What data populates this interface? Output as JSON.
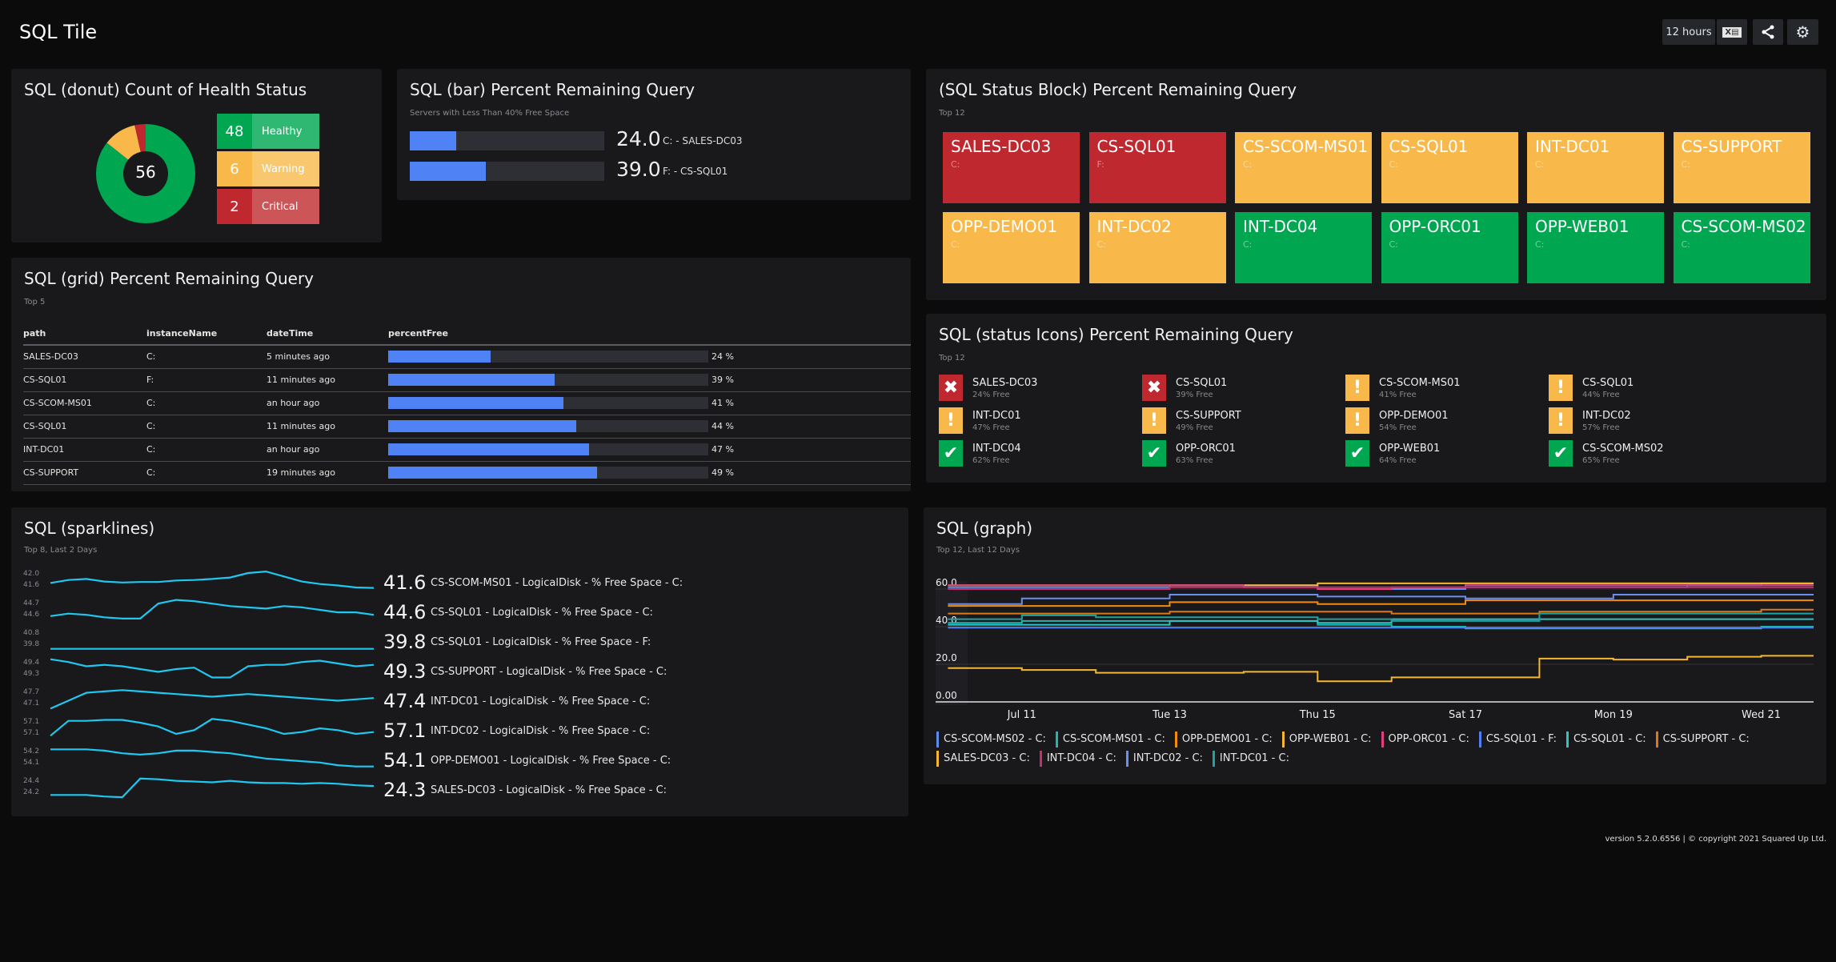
{
  "header": {
    "title": "SQL Tile",
    "time_range": "12 hours",
    "icons": [
      "excel-export-icon",
      "share-icon",
      "gear-icon"
    ]
  },
  "colors": {
    "healthy": "#00a650",
    "warning": "#f8b94a",
    "critical": "#c0282f",
    "bar": "#4f83f5",
    "spark": "#1ec8f0"
  },
  "donut": {
    "title": "SQL (donut) Count of Health Status",
    "total": "56",
    "items": [
      {
        "label": "Healthy",
        "count": 48,
        "count_text": "48",
        "status": "healthy"
      },
      {
        "label": "Warning",
        "count": 6,
        "count_text": "6",
        "status": "warning"
      },
      {
        "label": "Critical",
        "count": 2,
        "count_text": "2",
        "status": "critical"
      }
    ]
  },
  "bar": {
    "title": "SQL (bar) Percent Remaining Query",
    "subtitle": "Servers with Less Than 40% Free Space",
    "items": [
      {
        "value": 24.0,
        "value_text": "24.0",
        "label": "C: - SALES-DC03"
      },
      {
        "value": 39.0,
        "value_text": "39.0",
        "label": "F: - CS-SQL01"
      }
    ]
  },
  "grid": {
    "title": "SQL (grid) Percent Remaining Query",
    "subtitle": "Top 5",
    "columns": [
      "path",
      "instanceName",
      "dateTime",
      "percentFree"
    ],
    "rows": [
      {
        "path": "SALES-DC03",
        "instanceName": "C:",
        "dateTime": "5 minutes ago",
        "percentFree": 24,
        "percent_text": "24 %"
      },
      {
        "path": "CS-SQL01",
        "instanceName": "F:",
        "dateTime": "11 minutes ago",
        "percentFree": 39,
        "percent_text": "39 %"
      },
      {
        "path": "CS-SCOM-MS01",
        "instanceName": "C:",
        "dateTime": "an hour ago",
        "percentFree": 41,
        "percent_text": "41 %"
      },
      {
        "path": "CS-SQL01",
        "instanceName": "C:",
        "dateTime": "11 minutes ago",
        "percentFree": 44,
        "percent_text": "44 %"
      },
      {
        "path": "INT-DC01",
        "instanceName": "C:",
        "dateTime": "an hour ago",
        "percentFree": 47,
        "percent_text": "47 %"
      },
      {
        "path": "CS-SUPPORT",
        "instanceName": "C:",
        "dateTime": "19 minutes ago",
        "percentFree": 49,
        "percent_text": "49 %"
      }
    ]
  },
  "status_block": {
    "title": "(SQL Status Block) Percent Remaining Query",
    "subtitle": "Top 12",
    "tiles": [
      {
        "name": "SALES-DC03",
        "sub": "C:",
        "status": "critical"
      },
      {
        "name": "CS-SQL01",
        "sub": "F:",
        "status": "critical"
      },
      {
        "name": "CS-SCOM-MS01",
        "sub": "C:",
        "status": "warning"
      },
      {
        "name": "CS-SQL01",
        "sub": "C:",
        "status": "warning"
      },
      {
        "name": "INT-DC01",
        "sub": "C:",
        "status": "warning"
      },
      {
        "name": "CS-SUPPORT",
        "sub": "C:",
        "status": "warning"
      },
      {
        "name": "OPP-DEMO01",
        "sub": "C:",
        "status": "warning"
      },
      {
        "name": "INT-DC02",
        "sub": "C:",
        "status": "warning"
      },
      {
        "name": "INT-DC04",
        "sub": "C:",
        "status": "healthy"
      },
      {
        "name": "OPP-ORC01",
        "sub": "C:",
        "status": "healthy"
      },
      {
        "name": "OPP-WEB01",
        "sub": "C:",
        "status": "healthy"
      },
      {
        "name": "CS-SCOM-MS02",
        "sub": "C:",
        "status": "healthy"
      }
    ]
  },
  "status_icons": {
    "title": "SQL (status Icons) Percent Remaining Query",
    "subtitle": "Top 12",
    "items": [
      {
        "name": "SALES-DC03",
        "free": "24% Free",
        "status": "critical"
      },
      {
        "name": "CS-SQL01",
        "free": "39% Free",
        "status": "critical"
      },
      {
        "name": "CS-SCOM-MS01",
        "free": "41% Free",
        "status": "warning"
      },
      {
        "name": "CS-SQL01",
        "free": "44% Free",
        "status": "warning"
      },
      {
        "name": "INT-DC01",
        "free": "47% Free",
        "status": "warning"
      },
      {
        "name": "CS-SUPPORT",
        "free": "49% Free",
        "status": "warning"
      },
      {
        "name": "OPP-DEMO01",
        "free": "54% Free",
        "status": "warning"
      },
      {
        "name": "INT-DC02",
        "free": "57% Free",
        "status": "warning"
      },
      {
        "name": "INT-DC04",
        "free": "62% Free",
        "status": "healthy"
      },
      {
        "name": "OPP-ORC01",
        "free": "63% Free",
        "status": "healthy"
      },
      {
        "name": "OPP-WEB01",
        "free": "64% Free",
        "status": "healthy"
      },
      {
        "name": "CS-SCOM-MS02",
        "free": "65% Free",
        "status": "healthy"
      }
    ]
  },
  "sparklines": {
    "title": "SQL (sparklines)",
    "subtitle": "Top 8, Last 2 Days",
    "rows": [
      {
        "label": "CS-SCOM-MS01 - LogicalDisk - % Free Space - C:",
        "value": "41.6",
        "ticks": [
          "42.0",
          "41.6"
        ],
        "ylim": [
          41.55,
          42.0
        ],
        "values": [
          41.72,
          41.78,
          41.8,
          41.75,
          41.73,
          41.74,
          41.74,
          41.77,
          41.78,
          41.8,
          41.83,
          41.92,
          41.95,
          41.85,
          41.75,
          41.7,
          41.67,
          41.63,
          41.62
        ]
      },
      {
        "label": "CS-SQL01 - LogicalDisk - % Free Space - C:",
        "value": "44.6",
        "ticks": [
          "44.7",
          "44.6"
        ],
        "ylim": [
          44.56,
          44.74
        ],
        "values": [
          44.6,
          44.62,
          44.61,
          44.59,
          44.58,
          44.58,
          44.7,
          44.73,
          44.72,
          44.7,
          44.68,
          44.67,
          44.66,
          44.68,
          44.67,
          44.65,
          44.63,
          44.63,
          44.61
        ]
      },
      {
        "label": "CS-SQL01 - LogicalDisk - % Free Space - F:",
        "value": "39.8",
        "ticks": [
          "40.8",
          "39.8"
        ],
        "ylim": [
          39.7,
          40.9
        ],
        "values": [
          39.8,
          39.8,
          39.8,
          39.8,
          39.8,
          39.8,
          39.8,
          39.8,
          39.8,
          39.8,
          39.8,
          39.8,
          39.8,
          39.8,
          39.8,
          39.8,
          39.8,
          39.8,
          39.8
        ]
      },
      {
        "label": "CS-SUPPORT - LogicalDisk - % Free Space - C:",
        "value": "49.3",
        "ticks": [
          "49.4",
          "49.3"
        ],
        "ylim": [
          49.25,
          49.41
        ],
        "values": [
          49.4,
          49.38,
          49.35,
          49.36,
          49.35,
          49.33,
          49.31,
          49.33,
          49.34,
          49.27,
          49.27,
          49.35,
          49.36,
          49.36,
          49.38,
          49.39,
          49.37,
          49.35,
          49.36
        ]
      },
      {
        "label": "INT-DC01 - LogicalDisk - % Free Space - C:",
        "value": "47.4",
        "ticks": [
          "47.7",
          "47.1"
        ],
        "ylim": [
          46.95,
          47.8
        ],
        "values": [
          47.0,
          47.3,
          47.6,
          47.65,
          47.7,
          47.65,
          47.6,
          47.55,
          47.5,
          47.45,
          47.5,
          47.55,
          47.5,
          47.45,
          47.4,
          47.35,
          47.3,
          47.35,
          47.4
        ]
      },
      {
        "label": "INT-DC02 - LogicalDisk - % Free Space - C:",
        "value": "57.1",
        "ticks": [
          "57.1",
          "57.1"
        ],
        "ylim": [
          57.04,
          57.16
        ],
        "values": [
          57.06,
          57.14,
          57.14,
          57.145,
          57.145,
          57.13,
          57.11,
          57.07,
          57.09,
          57.15,
          57.14,
          57.12,
          57.1,
          57.07,
          57.08,
          57.1,
          57.09,
          57.07,
          57.08
        ]
      },
      {
        "label": "OPP-DEMO01 - LogicalDisk - % Free Space - C:",
        "value": "54.1",
        "ticks": [
          "54.2",
          "54.1"
        ],
        "ylim": [
          54.05,
          54.22
        ],
        "values": [
          54.2,
          54.2,
          54.2,
          54.19,
          54.17,
          54.16,
          54.17,
          54.19,
          54.19,
          54.18,
          54.17,
          54.15,
          54.13,
          54.12,
          54.11,
          54.1,
          54.08,
          54.07,
          54.07
        ]
      },
      {
        "label": "SALES-DC03 - LogicalDisk - % Free Space - C:",
        "value": "24.3",
        "ticks": [
          "24.4",
          "24.2"
        ],
        "ylim": [
          24.15,
          24.45
        ],
        "values": [
          24.2,
          24.2,
          24.2,
          24.18,
          24.17,
          24.42,
          24.41,
          24.39,
          24.38,
          24.37,
          24.39,
          24.37,
          24.36,
          24.36,
          24.35,
          24.36,
          24.35,
          24.33,
          24.32
        ]
      }
    ]
  },
  "chart_data": {
    "type": "line",
    "title": "SQL (graph)",
    "subtitle": "Top 12, Last 12 Days",
    "ylim": [
      0,
      65
    ],
    "yticks": [
      "0.00",
      "20.0",
      "40.0",
      "60.0"
    ],
    "ytick_values": [
      0,
      20,
      40,
      60
    ],
    "xlim": [
      "2021-07-09T20:00",
      "2021-07-21T17:00"
    ],
    "xticks": [
      "Jul 11",
      "Tue 13",
      "Thu 15",
      "Sat 17",
      "Mon 19",
      "Wed 21"
    ],
    "xtick_dates": [
      "2021-07-11",
      "2021-07-13",
      "2021-07-15",
      "2021-07-17",
      "2021-07-19",
      "2021-07-21"
    ],
    "grid": true,
    "legend": "bottom",
    "x": [
      "2021-07-10",
      "2021-07-11",
      "2021-07-12",
      "2021-07-13",
      "2021-07-14",
      "2021-07-15",
      "2021-07-16",
      "2021-07-17",
      "2021-07-18",
      "2021-07-19",
      "2021-07-20",
      "2021-07-21",
      "2021-07-21T17:00"
    ],
    "series": [
      {
        "name": "CS-SCOM-MS02 - C:",
        "color": "#5b8def",
        "values": [
          61,
          61,
          61,
          62,
          62,
          60,
          60,
          61,
          61,
          61,
          62,
          63,
          63
        ]
      },
      {
        "name": "CS-SCOM-MS01 - C:",
        "color": "#21b5b0",
        "values": [
          42,
          43,
          43,
          43,
          43,
          41,
          40,
          39,
          39,
          39,
          39,
          40,
          40
        ]
      },
      {
        "name": "OPP-DEMO01 - C:",
        "color": "#f28c0f",
        "values": [
          51,
          51,
          51,
          53,
          53,
          52,
          52,
          54,
          54,
          54,
          54,
          54,
          54
        ]
      },
      {
        "name": "OPP-WEB01 - C:",
        "color": "#f5b731",
        "values": [
          62,
          62,
          62,
          62,
          62,
          63,
          63,
          63,
          63,
          63,
          63,
          63,
          63
        ]
      },
      {
        "name": "OPP-ORC01 - C:",
        "color": "#e0407f",
        "values": [
          62,
          62,
          62,
          62,
          61,
          60,
          61,
          62,
          62,
          62,
          62,
          62,
          62
        ]
      },
      {
        "name": "CS-SQL01 - F:",
        "color": "#4f7ff0",
        "values": [
          39.5,
          39.5,
          39.5,
          39.5,
          39.5,
          39.5,
          39.5,
          39.5,
          39.5,
          39.5,
          39.5,
          39.5,
          39.5
        ]
      },
      {
        "name": "CS-SQL01 - C:",
        "color": "#2ec4c4",
        "values": [
          41,
          41,
          41,
          43,
          43,
          42,
          44,
          44,
          44,
          44,
          44,
          44,
          44
        ]
      },
      {
        "name": "CS-SUPPORT - C:",
        "color": "#d97a1a",
        "values": [
          47,
          47,
          47,
          48,
          48,
          48,
          47,
          47,
          48,
          48,
          48,
          49,
          49
        ]
      },
      {
        "name": "SALES-DC03 - C:",
        "color": "#f5b731",
        "values": [
          18,
          17,
          15.5,
          15.5,
          16,
          11,
          13,
          13,
          23,
          22.5,
          24,
          24.5,
          24.5
        ]
      },
      {
        "name": "INT-DC04 - C:",
        "color": "#c2306e",
        "values": [
          60,
          60,
          60,
          61,
          61,
          61,
          61,
          61,
          61,
          61,
          61,
          61,
          61
        ]
      },
      {
        "name": "INT-DC02 - C:",
        "color": "#6a8ff0",
        "values": [
          52,
          55,
          55,
          57,
          57,
          56,
          56,
          55,
          55,
          57,
          57,
          57,
          57
        ]
      },
      {
        "name": "INT-DC01 - C:",
        "color": "#1fa3a0",
        "values": [
          44,
          46,
          45,
          45,
          45,
          44,
          43,
          43,
          47,
          47,
          47,
          47,
          47
        ]
      }
    ]
  },
  "footer": {
    "text": "version 5.2.0.6556 | © copyright 2021 Squared Up Ltd."
  }
}
